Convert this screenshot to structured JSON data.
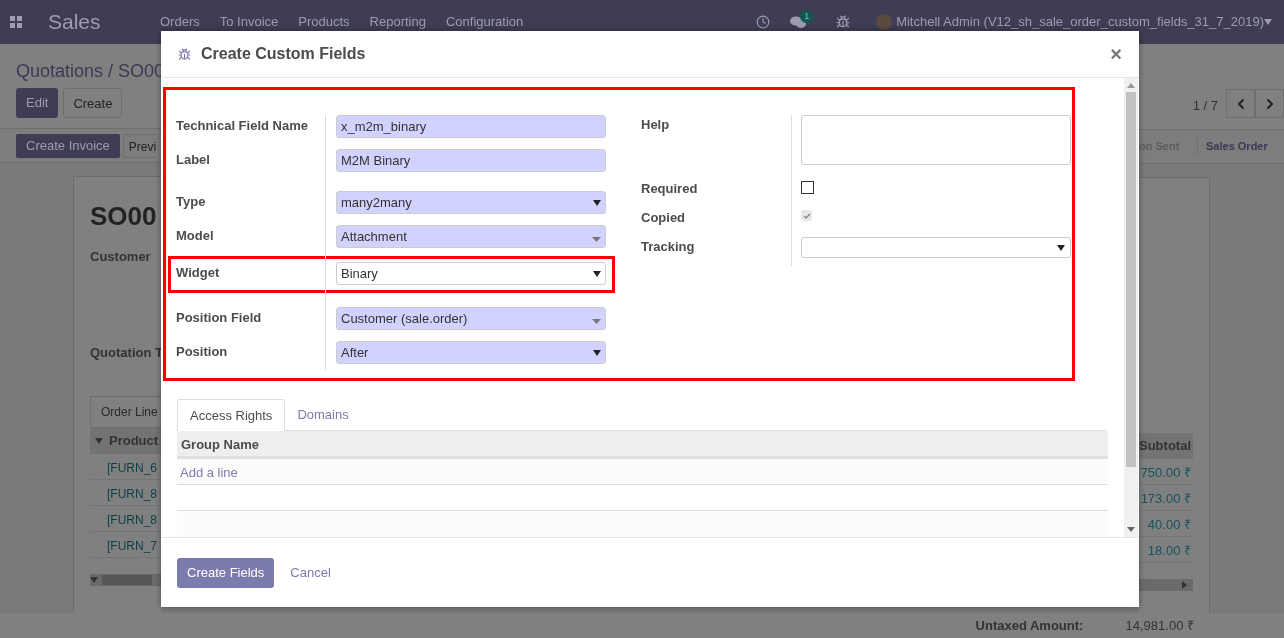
{
  "navbar": {
    "app_title": "Sales",
    "menu": [
      "Orders",
      "To Invoice",
      "Products",
      "Reporting",
      "Configuration"
    ],
    "message_count": "1",
    "user": "Mitchell Admin (V12_sh_sale_order_custom_fields_31_7_2019)"
  },
  "page": {
    "breadcrumb": "Quotations / SO00",
    "buttons": [
      "Edit",
      "Create"
    ],
    "pager": "1 / 7",
    "action_buttons": [
      "Create Invoice",
      "Previ"
    ],
    "stages": [
      {
        "label": "on Sent",
        "selected": false
      },
      {
        "label": "Sales Order",
        "selected": true
      }
    ],
    "record_name": "SO00",
    "labels": [
      "Customer",
      "Quotation T"
    ],
    "tab": "Order Line",
    "columns": [
      "Product",
      "Subtotal"
    ],
    "rows": [
      {
        "product": "[FURN_6",
        "subtotal": "750.00 ₹"
      },
      {
        "product": "[FURN_8",
        "subtotal": "173.00 ₹"
      },
      {
        "product": "[FURN_8",
        "subtotal": "40.00 ₹"
      },
      {
        "product": "[FURN_7",
        "subtotal": "18.00 ₹"
      }
    ],
    "untaxed_label": "Untaxed Amount:",
    "untaxed_value": "14,981.00 ₹"
  },
  "dialog": {
    "title": "Create Custom Fields",
    "close": "×",
    "left_fields": [
      {
        "label": "Technical Field Name",
        "value": "x_m2m_binary",
        "kind": "input",
        "required": true,
        "highlighted": false
      },
      {
        "label": "Label",
        "value": "M2M Binary",
        "kind": "input",
        "required": true,
        "highlighted": false
      },
      {
        "label": "Type",
        "value": "many2many",
        "kind": "select",
        "required": true,
        "highlighted": false
      },
      {
        "label": "Model",
        "value": "Attachment",
        "kind": "many2one",
        "required": true,
        "highlighted": false
      },
      {
        "label": "Widget",
        "value": "Binary",
        "kind": "select",
        "required": false,
        "highlighted": true
      },
      {
        "label": "Position Field",
        "value": "Customer (sale.order)",
        "kind": "many2one",
        "required": true,
        "highlighted": false
      },
      {
        "label": "Position",
        "value": "After",
        "kind": "select",
        "required": true,
        "highlighted": false
      }
    ],
    "right_fields": [
      {
        "label": "Help",
        "kind": "textarea"
      },
      {
        "label": "Required",
        "kind": "checkbox",
        "checked": false
      },
      {
        "label": "Copied",
        "kind": "checkbox",
        "checked": true
      },
      {
        "label": "Tracking",
        "kind": "select"
      }
    ],
    "tabs": [
      {
        "label": "Access Rights",
        "selected": true
      },
      {
        "label": "Domains",
        "selected": false
      }
    ],
    "table_column": "Group Name",
    "add_line": "Add a line",
    "primary_button": "Create Fields",
    "cancel_button": "Cancel"
  }
}
